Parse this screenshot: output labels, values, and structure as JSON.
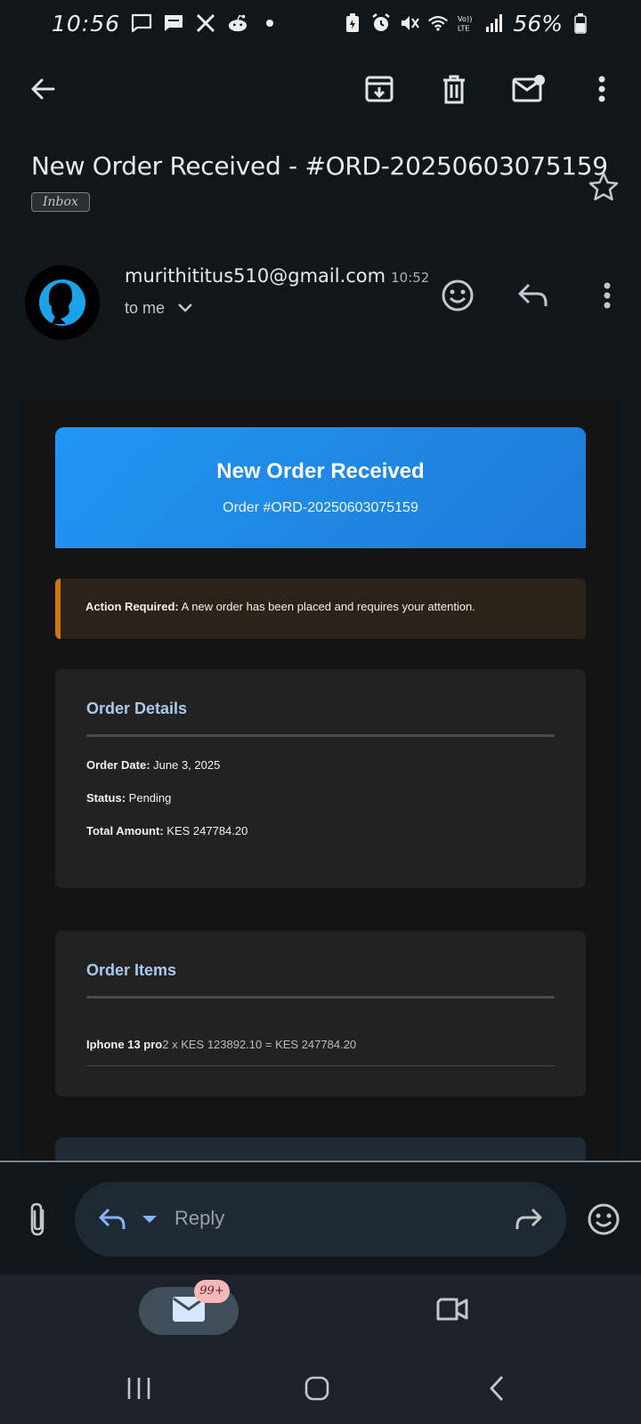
{
  "status_bar": {
    "time": "10:56",
    "battery_percent": "56%",
    "icons": [
      "message-icon",
      "chat-icon",
      "x-icon",
      "reddit-icon",
      "dot-icon",
      "battery-saver-icon",
      "alarm-icon",
      "mute-icon",
      "wifi-icon",
      "volte-icon",
      "signal-icon",
      "battery-icon"
    ]
  },
  "app_bar": {
    "icons": [
      "back-arrow-icon",
      "archive-icon",
      "delete-icon",
      "mark-unread-icon",
      "more-vert-icon"
    ]
  },
  "email": {
    "subject": "New Order Received - #ORD-20250603075159",
    "label": "Inbox",
    "sender": "murithititus510@gmail.com",
    "time": "10:52",
    "to": "to me"
  },
  "body": {
    "hero_title": "New Order Received",
    "hero_subtitle": "Order #ORD-20250603075159",
    "alert_strong": "Action Required:",
    "alert_text": " A new order has been placed and requires your attention.",
    "details": {
      "title": "Order Details",
      "date_label": "Order Date:",
      "date_value": " June 3, 2025",
      "status_label": "Status:",
      "status_value": " Pending",
      "total_label": "Total Amount:",
      "total_value": " KES 247784.20"
    },
    "items": {
      "title": "Order Items",
      "rows": [
        {
          "name": "Iphone 13 pro",
          "calc": "2 x KES 123892.10 = KES 247784.20"
        }
      ]
    }
  },
  "reply_bar": {
    "placeholder": "Reply"
  },
  "bottom_nav": {
    "mail_badge": "99+"
  },
  "colors": {
    "background": "#0f161c",
    "hero_blue": "#2196f3",
    "alert_accent": "#c77a12",
    "panel_title": "#a9c9ee",
    "avatar_blue": "#1aa3e8"
  }
}
